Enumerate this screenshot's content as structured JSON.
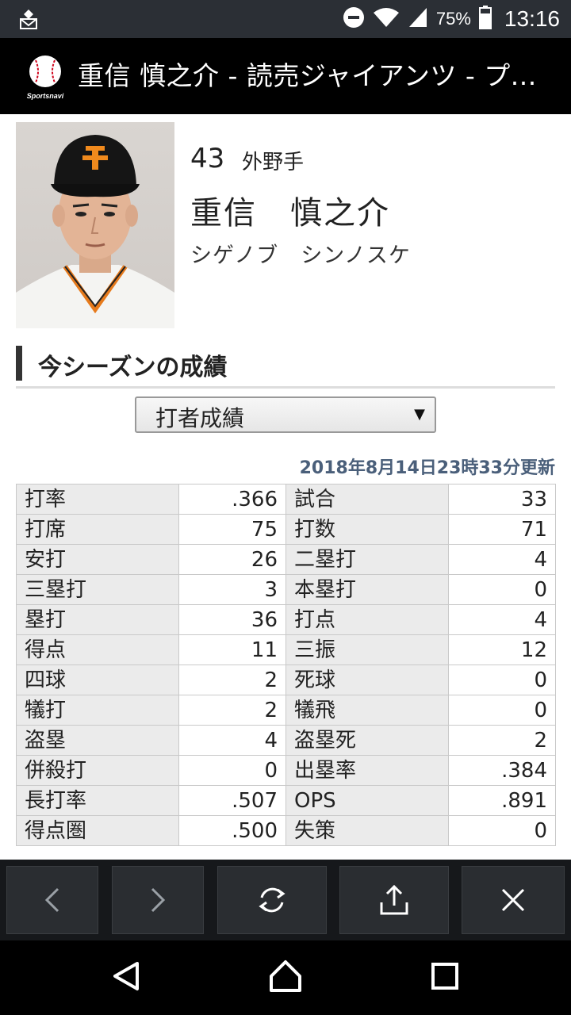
{
  "status_bar": {
    "battery_percent": "75%",
    "time": "13:16"
  },
  "app_bar": {
    "title": "重信 慎之介 - 読売ジャイアンツ - プ...",
    "logo_text": "Sportsnavi"
  },
  "player": {
    "number": "43",
    "position": "外野手",
    "name": "重信　慎之介",
    "kana": "シゲノブ　シンノスケ"
  },
  "section": {
    "title": "今シーズンの成績"
  },
  "stat_select": {
    "selected": "打者成績"
  },
  "updated": "2018年8月14日23時33分更新",
  "stats": {
    "rows": [
      {
        "l1": "打率",
        "v1": ".366",
        "l2": "試合",
        "v2": "33"
      },
      {
        "l1": "打席",
        "v1": "75",
        "l2": "打数",
        "v2": "71"
      },
      {
        "l1": "安打",
        "v1": "26",
        "l2": "二塁打",
        "v2": "4"
      },
      {
        "l1": "三塁打",
        "v1": "3",
        "l2": "本塁打",
        "v2": "0"
      },
      {
        "l1": "塁打",
        "v1": "36",
        "l2": "打点",
        "v2": "4"
      },
      {
        "l1": "得点",
        "v1": "11",
        "l2": "三振",
        "v2": "12"
      },
      {
        "l1": "四球",
        "v1": "2",
        "l2": "死球",
        "v2": "0"
      },
      {
        "l1": "犠打",
        "v1": "2",
        "l2": "犠飛",
        "v2": "0"
      },
      {
        "l1": "盗塁",
        "v1": "4",
        "l2": "盗塁死",
        "v2": "2"
      },
      {
        "l1": "併殺打",
        "v1": "0",
        "l2": "出塁率",
        "v2": ".384"
      },
      {
        "l1": "長打率",
        "v1": ".507",
        "l2": "OPS",
        "v2": ".891"
      },
      {
        "l1": "得点圏",
        "v1": ".500",
        "l2": "失策",
        "v2": "0"
      }
    ]
  },
  "toolbar": {
    "icons": [
      "back-icon",
      "forward-icon",
      "refresh-icon",
      "share-icon",
      "close-icon"
    ]
  },
  "nav_bar": {
    "icons": [
      "nav-back-icon",
      "nav-home-icon",
      "nav-recents-icon"
    ]
  },
  "colors": {
    "status_bar_bg": "#2b2f35",
    "app_bar_bg": "#000000",
    "updated_text": "#4a5f7a",
    "table_label_bg": "#ebebeb",
    "toolbar_bg": "#16181b"
  }
}
